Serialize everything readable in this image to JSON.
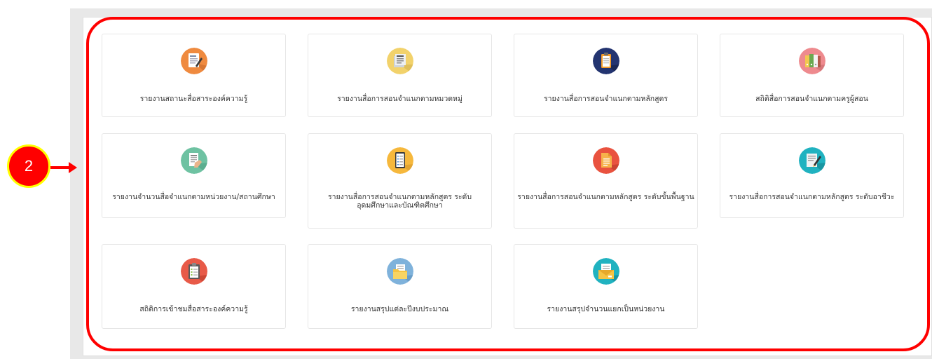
{
  "step_marker": {
    "number": "2"
  },
  "report_cards": [
    {
      "label": "รายงานสถานะสื่อสาระองค์ความรู้",
      "icon": "document-form-icon",
      "color": "#ef8a3f"
    },
    {
      "label": "รายงานสื่อการสอนจำแนกตามหมวดหมู่",
      "icon": "papers-stack-icon",
      "color": "#f2d26b"
    },
    {
      "label": "รายงานสื่อการสอนจำแนกตามหลักสูตร",
      "icon": "clipboard-icon",
      "color": "#233470"
    },
    {
      "label": "สถิติสื่อการสอนจำแนกตามครูผู้สอน",
      "icon": "binders-icon",
      "color": "#ee8a8e"
    },
    {
      "label": "รายงานจำนวนสื่อจำแนกตามหน่วยงาน/สถานศึกษา",
      "icon": "document-hand-icon",
      "color": "#6ec2a2"
    },
    {
      "label": "รายงานสื่อการสอนจำแนกตามหลักสูตร ระดับอุดมศึกษาและบัณฑิตศึกษา",
      "icon": "checklist-icon",
      "color": "#f6b83c"
    },
    {
      "label": "รายงานสื่อการสอนจำแนกตามหลักสูตร ระดับขั้นพื้นฐาน",
      "icon": "document-icon",
      "color": "#e9523f"
    },
    {
      "label": "รายงานสื่อการสอนจำแนกตามหลักสูตร ระดับอาชีวะ",
      "icon": "edit-document-icon",
      "color": "#20b2c0"
    },
    {
      "label": "สถิติการเข้าชมสื่อสาระองค์ความรู้",
      "icon": "clipboard-list-icon",
      "color": "#e85a48"
    },
    {
      "label": "รายงานสรุปแต่ละปีงบประมาณ",
      "icon": "folder-icon",
      "color": "#7fb2db"
    },
    {
      "label": "รายงานสรุปจำนวนแยกเป็นหน่วยงาน",
      "icon": "envelope-icon",
      "color": "#20b2c0"
    }
  ]
}
